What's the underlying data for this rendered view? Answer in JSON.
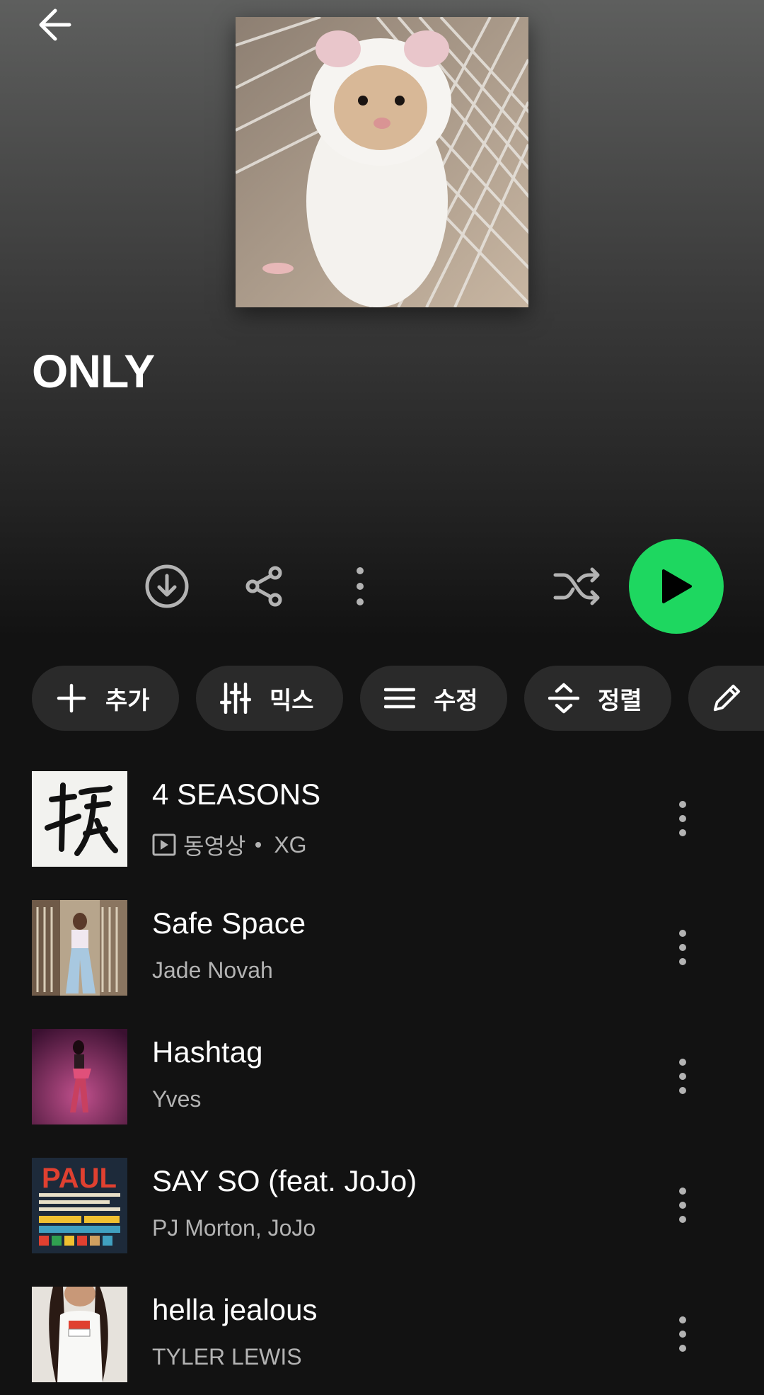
{
  "header": {
    "back_icon": "arrow-left-icon"
  },
  "playlist": {
    "title": "ONLY",
    "cover_description": "hamster"
  },
  "actions": {
    "download_icon": "download-circle-icon",
    "share_icon": "share-icon",
    "more_icon": "more-vertical-icon",
    "shuffle_icon": "shuffle-icon",
    "play_icon": "play-icon",
    "play_color": "#1ed760"
  },
  "chips": [
    {
      "label": "추가",
      "icon": "plus-icon"
    },
    {
      "label": "믹스",
      "icon": "sliders-icon"
    },
    {
      "label": "수정",
      "icon": "list-icon"
    },
    {
      "label": "정렬",
      "icon": "sort-icon"
    },
    {
      "label": "",
      "icon": "pencil-icon"
    }
  ],
  "tracks": [
    {
      "title": "4 SEASONS",
      "badge": "동영상",
      "artist": "XG",
      "thumb": "calligraphy"
    },
    {
      "title": "Safe Space",
      "artist": "Jade Novah",
      "thumb": "street"
    },
    {
      "title": "Hashtag",
      "artist": "Yves",
      "thumb": "magenta"
    },
    {
      "title": "SAY SO (feat. JoJo)",
      "artist": "PJ Morton, JoJo",
      "thumb": "poster",
      "poster_text": "PAUL"
    },
    {
      "title": "hella jealous",
      "artist": "TYLER LEWIS",
      "thumb": "white-tee"
    }
  ]
}
